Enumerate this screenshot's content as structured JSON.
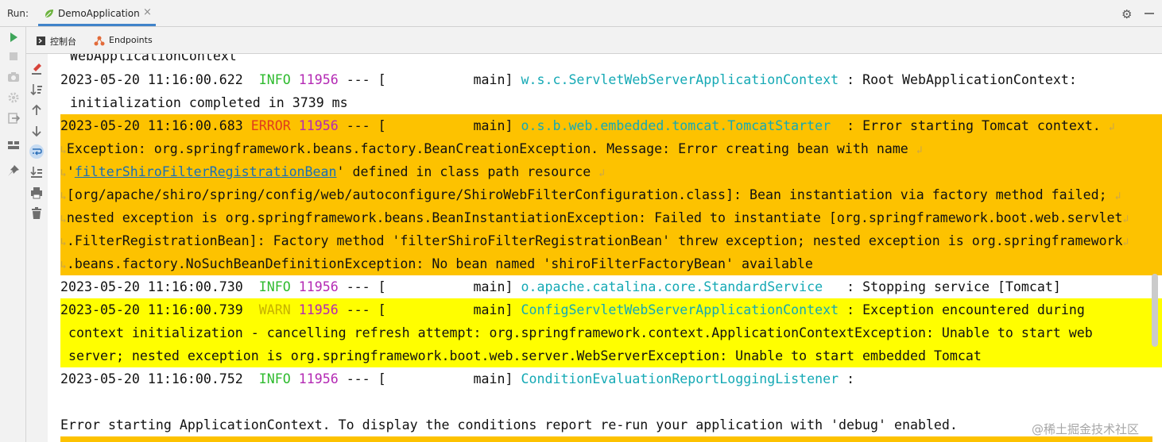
{
  "topbar": {
    "run_label": "Run:",
    "tab_label": "DemoApplication",
    "tab_close": "×"
  },
  "subbar": {
    "console_tab": "控制台",
    "endpoints_tab": "Endpoints"
  },
  "console": {
    "cut_top": "WebApplicationContext",
    "l1": {
      "ts": "2023-05-20 11:16:00.622",
      "level": "INFO",
      "pid": "11956",
      "sep": "---",
      "thread": "main",
      "logger": "w.s.c.ServletWebServerApplicationContext",
      "msg": ": Root WebApplicationContext:"
    },
    "l1b": "initialization completed in 3739 ms",
    "l2": {
      "ts": "2023-05-20 11:16:00.683",
      "level": "ERROR",
      "pid": "11956",
      "sep": "---",
      "thread": "main",
      "logger": "o.s.b.web.embedded.tomcat.TomcatStarter",
      "msg": ": Error starting Tomcat context."
    },
    "l2b": "Exception: org.springframework.beans.factory.BeanCreationException. Message: Error creating bean with name",
    "l2c_pre": "'",
    "l2c_link": "filterShiroFilterRegistrationBean",
    "l2c_post": "' defined in class path resource",
    "l2d": "[org/apache/shiro/spring/config/web/autoconfigure/ShiroWebFilterConfiguration.class]: Bean instantiation via factory method failed;",
    "l2e": "nested exception is org.springframework.beans.BeanInstantiationException: Failed to instantiate [org.springframework.boot.web.servlet",
    "l2f": ".FilterRegistrationBean]: Factory method 'filterShiroFilterRegistrationBean' threw exception; nested exception is org.springframework",
    "l2g": ".beans.factory.NoSuchBeanDefinitionException: No bean named 'shiroFilterFactoryBean' available",
    "l3": {
      "ts": "2023-05-20 11:16:00.730",
      "level": "INFO",
      "pid": "11956",
      "sep": "---",
      "thread": "main",
      "logger": "o.apache.catalina.core.StandardService",
      "msg": ": Stopping service [Tomcat]"
    },
    "l4": {
      "ts": "2023-05-20 11:16:00.739",
      "level": "WARN",
      "pid": "11956",
      "sep": "---",
      "thread": "main",
      "logger": "ConfigServletWebServerApplicationContext",
      "msg": ": Exception encountered during"
    },
    "l4b": "context initialization - cancelling refresh attempt: org.springframework.context.ApplicationContextException: Unable to start web",
    "l4c": "server; nested exception is org.springframework.boot.web.server.WebServerException: Unable to start embedded Tomcat",
    "l5": {
      "ts": "2023-05-20 11:16:00.752",
      "level": "INFO",
      "pid": "11956",
      "sep": "---",
      "thread": "main",
      "logger": "ConditionEvaluationReportLoggingListener",
      "msg": ":"
    },
    "l6": "Error starting ApplicationContext. To display the conditions report re-run your application with 'debug' enabled."
  },
  "watermark": "@稀土掘金技术社区",
  "colors": {
    "error_highlight": "#fdc200",
    "warn_highlight": "#fffe00",
    "info_level": "#2fbb2f",
    "pid": "#b42ab4",
    "logger": "#15a9b5",
    "error_level": "#e03b1d",
    "link": "#1b6fb5"
  }
}
